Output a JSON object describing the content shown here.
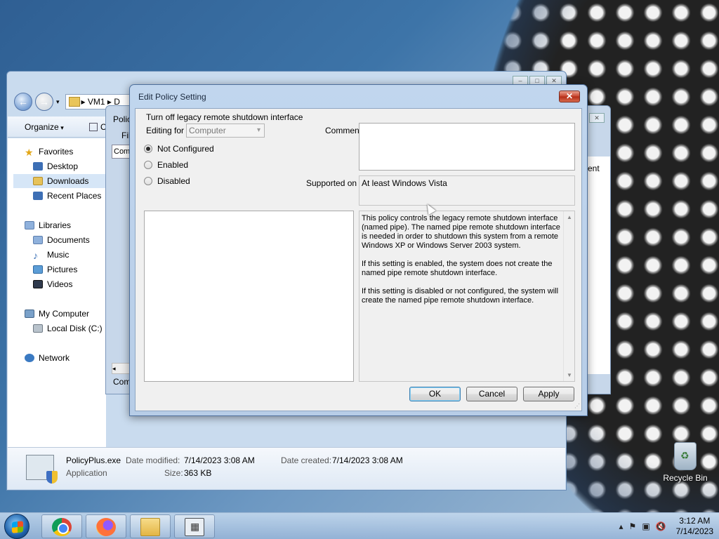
{
  "desktop": {
    "recycle_bin_label": "Recycle Bin"
  },
  "explorer": {
    "address_crumb": "VM1",
    "address_next": "D",
    "organize_label": "Organize",
    "toolbar_next": "C",
    "nav": [
      {
        "label": "Favorites",
        "icon": "star-icon"
      },
      {
        "label": "Desktop",
        "icon": "desktop-icon"
      },
      {
        "label": "Downloads",
        "icon": "downloads-folder-icon",
        "selected": true
      },
      {
        "label": "Recent Places",
        "icon": "recent-places-icon"
      },
      {
        "label": "Libraries",
        "icon": "libraries-icon"
      },
      {
        "label": "Documents",
        "icon": "documents-icon"
      },
      {
        "label": "Music",
        "icon": "music-icon"
      },
      {
        "label": "Pictures",
        "icon": "pictures-icon"
      },
      {
        "label": "Videos",
        "icon": "videos-icon"
      },
      {
        "label": "My Computer",
        "icon": "computer-icon"
      },
      {
        "label": "Local Disk (C:)",
        "icon": "disk-icon"
      },
      {
        "label": "Network",
        "icon": "network-icon"
      }
    ],
    "details": {
      "file_name": "PolicyPlus.exe",
      "file_type": "Application",
      "date_modified_label": "Date modified:",
      "date_modified": "7/14/2023 3:08 AM",
      "date_created_label": "Date created:",
      "date_created": "7/14/2023 3:08 AM",
      "size_label": "Size:",
      "size": "363 KB"
    }
  },
  "policyplus_window": {
    "title_fragment": "Polic",
    "menu_fragment": "Fil",
    "combo_fragment": "Comp",
    "right_fragment": "ent",
    "status_fragment": "Com"
  },
  "dialog": {
    "title": "Edit Policy Setting",
    "close_glyph": "✕",
    "policy_name": "Turn off legacy remote shutdown interface",
    "editing_for_label": "Editing for",
    "editing_for_value": "Computer",
    "options": [
      {
        "label": "Not Configured",
        "checked": true
      },
      {
        "label": "Enabled",
        "checked": false
      },
      {
        "label": "Disabled",
        "checked": false
      }
    ],
    "comment_label": "Comment",
    "comment_value": "",
    "supported_on_label": "Supported on",
    "supported_on_value": "At least Windows Vista",
    "help_paragraphs": [
      "This policy controls the legacy remote shutdown interface (named pipe). The named pipe remote shutdown interface is needed in order to shutdown this system from a remote Windows XP or Windows Server 2003 system.",
      "If this setting is enabled, the system does not create the named pipe remote shutdown interface.",
      "If this setting is disabled or not configured, the system will create the named pipe remote shutdown interface."
    ],
    "ok_label": "OK",
    "cancel_label": "Cancel",
    "apply_label": "Apply"
  },
  "taskbar": {
    "pinned": [
      "chrome-icon",
      "firefox-icon",
      "explorer-folder-icon",
      "policyplus-icon"
    ],
    "time": "3:12 AM",
    "date": "7/14/2023"
  }
}
